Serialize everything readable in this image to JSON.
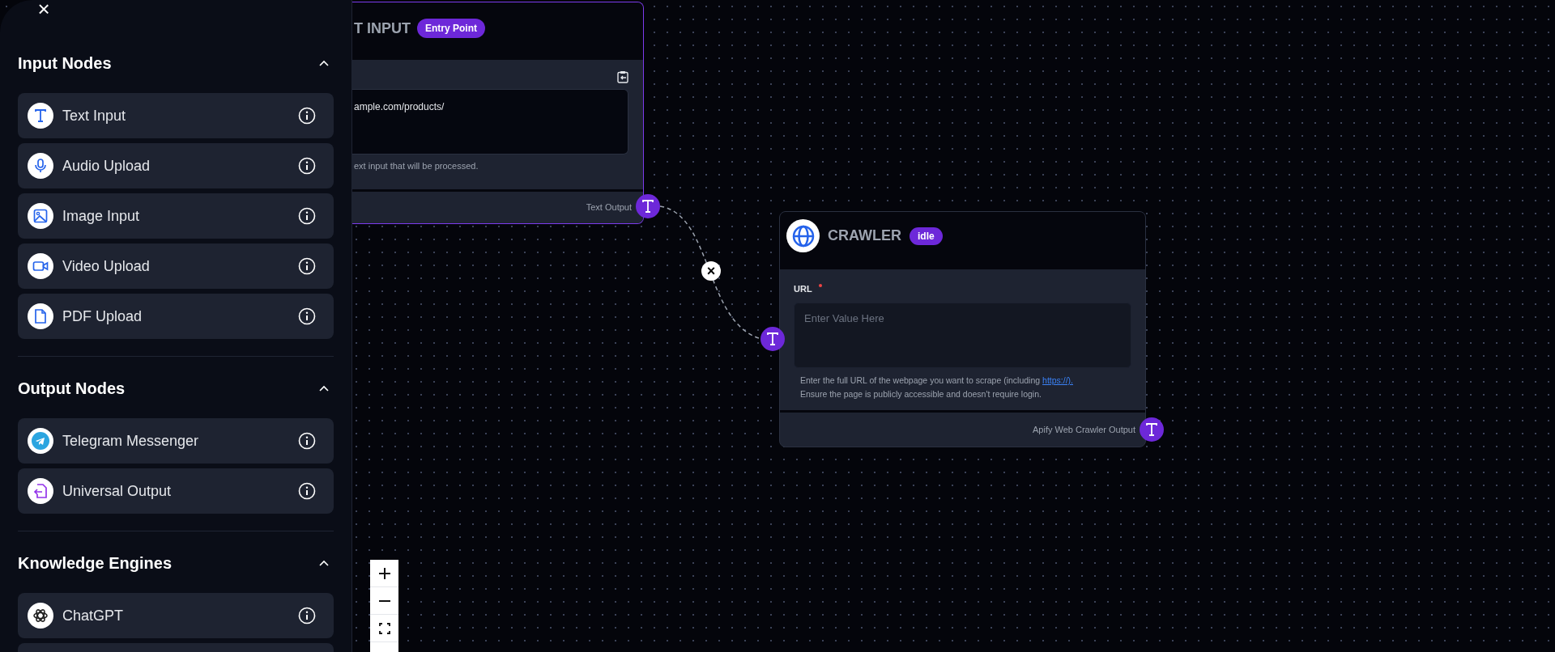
{
  "sidebar": {
    "close": "×",
    "sections": [
      {
        "title": "Input Nodes",
        "expanded": true,
        "items": [
          {
            "label": "Text Input"
          },
          {
            "label": "Audio Upload"
          },
          {
            "label": "Image Input"
          },
          {
            "label": "Video Upload"
          },
          {
            "label": "PDF Upload"
          }
        ]
      },
      {
        "title": "Output Nodes",
        "expanded": true,
        "items": [
          {
            "label": "Telegram Messenger"
          },
          {
            "label": "Universal Output"
          }
        ]
      },
      {
        "title": "Knowledge Engines",
        "expanded": true,
        "items": [
          {
            "label": "ChatGPT"
          }
        ]
      }
    ]
  },
  "nodes": [
    {
      "title": "T INPUT",
      "badge": "Entry Point",
      "selected": true,
      "value": "ample.com/products/",
      "help": "ext input that will be processed.",
      "output": "Text Output"
    },
    {
      "title": "CRAWLER",
      "badge": "idle",
      "selected": false,
      "field_label": "URL",
      "required": true,
      "placeholder": "Enter Value Here",
      "help": "Enter the full URL of the webpage you want to scrape (including",
      "link": "https://).",
      "help_2": "Ensure the page is publicly accessible and doesn't require login.",
      "output": "Apify Web Crawler Output"
    }
  ],
  "edge": {
    "remove": "×"
  }
}
